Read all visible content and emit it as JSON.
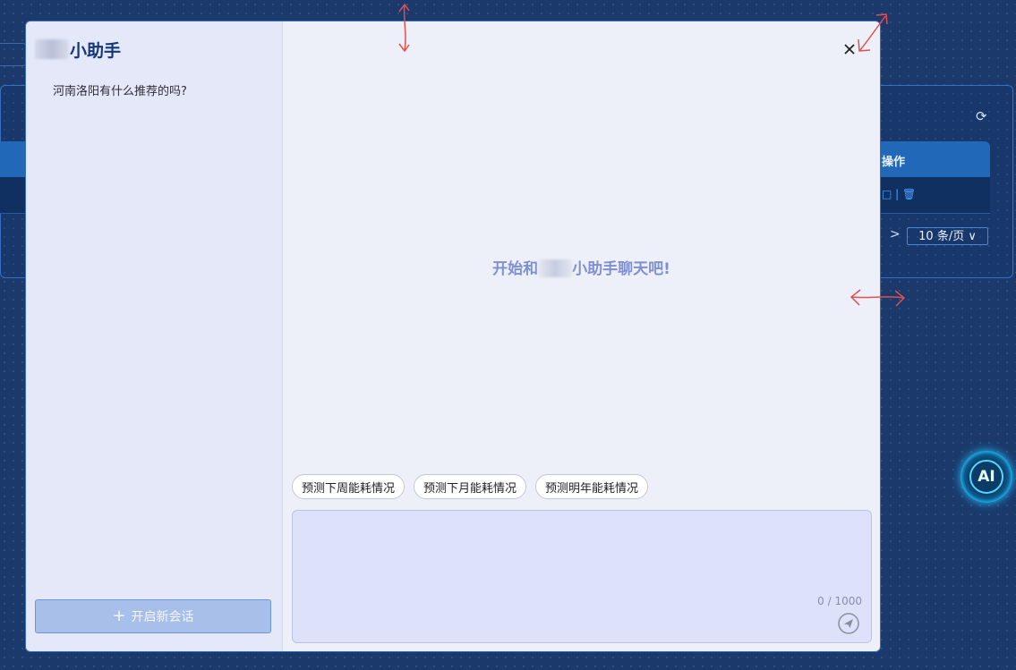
{
  "background": {
    "table_op_header": "操作",
    "refresh_icon": "refresh-icon",
    "row_actions": "□ | 🗑",
    "next_page": ">",
    "page_size": "10 条/页",
    "ai_button_label": "AI"
  },
  "sidebar": {
    "brand_suffix": "小助手",
    "history": [
      "河南洛阳有什么推荐的吗?"
    ],
    "new_chat_label": "开启新会话"
  },
  "main": {
    "welcome_prefix": "开始和",
    "welcome_suffix": "小助手聊天吧!",
    "suggestions": [
      "预测下周能耗情况",
      "预测下月能耗情况",
      "预测明年能耗情况"
    ],
    "input": {
      "value": "",
      "counter": "0 / 1000"
    }
  },
  "colors": {
    "accent": "#16367a",
    "welcome": "#7f8fd4",
    "annotation": "#e05050"
  }
}
